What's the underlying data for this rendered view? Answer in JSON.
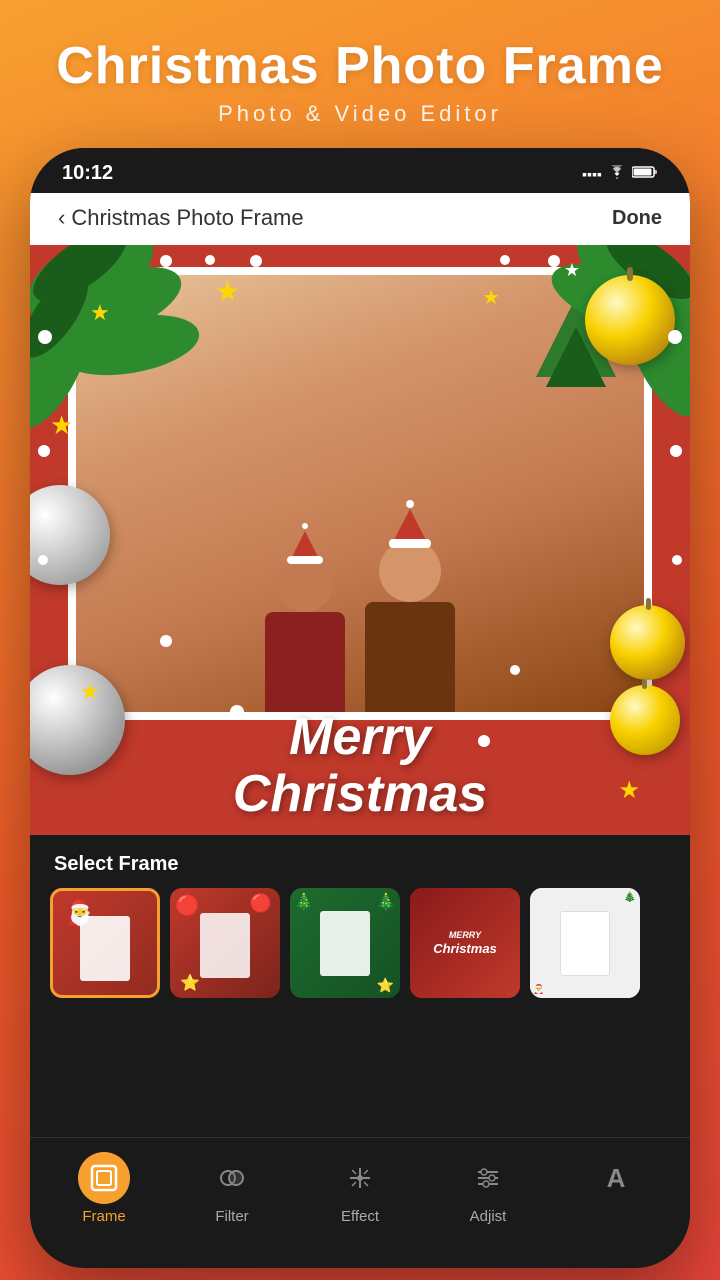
{
  "app": {
    "title": "Christmas Photo Frame",
    "subtitle": "Photo & Video Editor"
  },
  "status_bar": {
    "time": "10:12",
    "icons": ".... ▲ 🔋"
  },
  "nav": {
    "back_label": "< Christmas Photo Frame",
    "done_label": "Done",
    "title": "Christmas Photo Frame"
  },
  "frame_area": {
    "merry_line1": "Merry",
    "merry_line2": "Christmas"
  },
  "bottom_panel": {
    "select_frame_label": "Select Frame",
    "frames": [
      {
        "id": 1,
        "active": true
      },
      {
        "id": 2,
        "active": false
      },
      {
        "id": 3,
        "active": false
      },
      {
        "id": 4,
        "active": false
      },
      {
        "id": 5,
        "active": false
      }
    ]
  },
  "toolbar": {
    "items": [
      {
        "id": "frame",
        "label": "Frame",
        "active": true,
        "icon": "frame-icon"
      },
      {
        "id": "filter",
        "label": "Filter",
        "active": false,
        "icon": "filter-icon"
      },
      {
        "id": "effect",
        "label": "Effect",
        "active": false,
        "icon": "effect-icon"
      },
      {
        "id": "adjust",
        "label": "Adjist",
        "active": false,
        "icon": "adjust-icon"
      },
      {
        "id": "more",
        "label": "A",
        "active": false,
        "icon": "more-icon"
      }
    ]
  },
  "colors": {
    "orange": "#f7a030",
    "red": "#c0392b",
    "dark": "#1a1a1a",
    "white": "#ffffff"
  }
}
